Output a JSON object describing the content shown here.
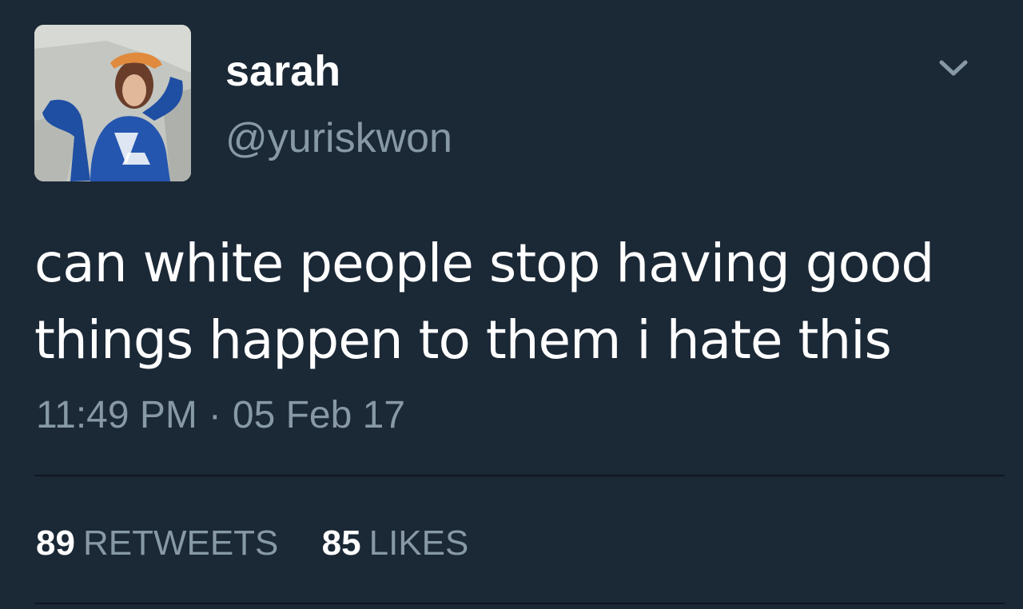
{
  "user": {
    "display_name": "sarah",
    "handle": "@yuriskwon"
  },
  "tweet": {
    "text": "can white people stop having good things happen to them i hate this",
    "time": "11:49 PM",
    "separator": "·",
    "date": "05 Feb 17"
  },
  "stats": {
    "retweets_count": "89",
    "retweets_label": "RETWEETS",
    "likes_count": "85",
    "likes_label": "LIKES"
  },
  "icons": {
    "menu": "chevron-down-icon"
  },
  "colors": {
    "background": "#1b2836",
    "primary_text": "#ffffff",
    "secondary_text": "#8899a6",
    "divider": "#0e161f"
  }
}
